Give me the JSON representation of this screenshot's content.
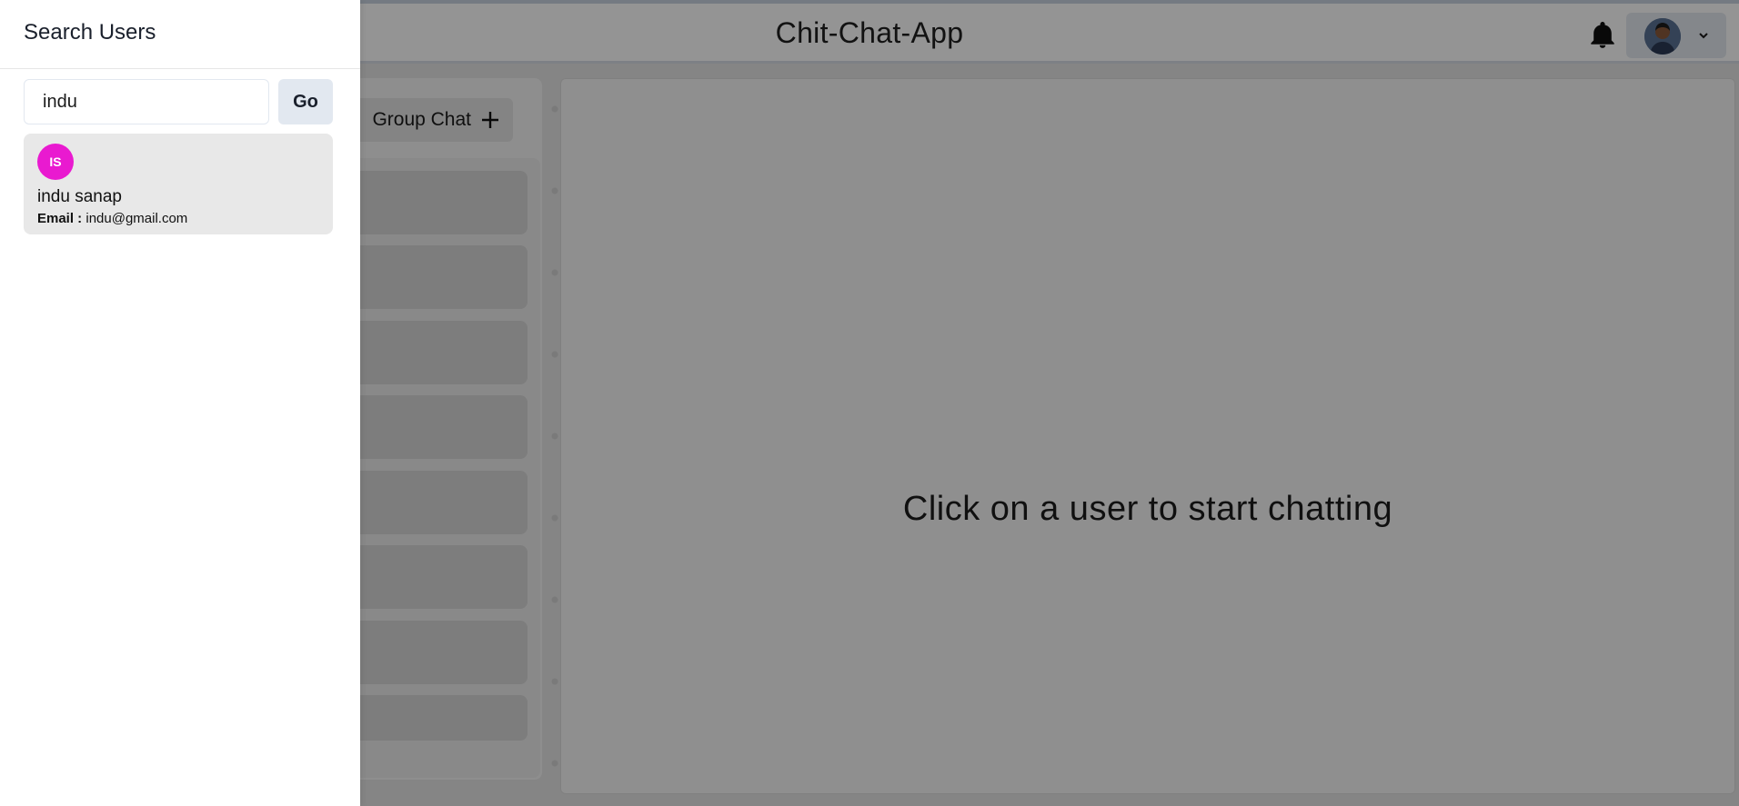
{
  "header": {
    "app_title": "Chit-Chat-App"
  },
  "my_chats": {
    "new_group_label": "Group Chat",
    "row_count_visible": 8
  },
  "chat_pane": {
    "placeholder": "Click on a user to start chatting"
  },
  "drawer": {
    "title": "Search Users",
    "search_value": "indu",
    "go_label": "Go",
    "results": [
      {
        "initials": "IS",
        "name": "indu sanap",
        "email_label": "Email :",
        "email": "indu@gmail.com"
      }
    ]
  },
  "colors": {
    "avatar_bg": "#e91ad0",
    "overlay": "rgba(0,0,0,0.42)"
  }
}
